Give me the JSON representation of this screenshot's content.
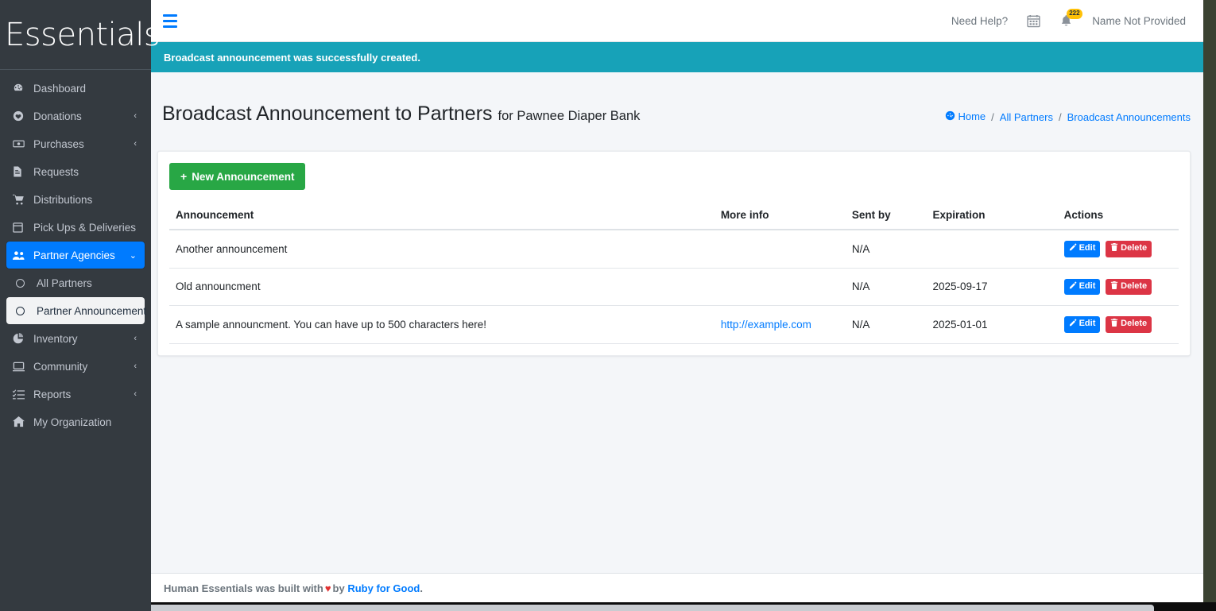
{
  "brand": {
    "name": "Essentials"
  },
  "sidebar": {
    "items": [
      {
        "label": "Dashboard",
        "icon": "dashboard-icon",
        "glyph": "◔",
        "caret": "",
        "state": "normal"
      },
      {
        "label": "Donations",
        "icon": "heart-circle-icon",
        "glyph": "♥",
        "caret": "‹",
        "state": "normal"
      },
      {
        "label": "Purchases",
        "icon": "money-bill-icon",
        "glyph": "▣",
        "caret": "‹",
        "state": "normal"
      },
      {
        "label": "Requests",
        "icon": "file-lines-icon",
        "glyph": "☷",
        "caret": "",
        "state": "normal"
      },
      {
        "label": "Distributions",
        "icon": "shopping-cart-icon",
        "glyph": "⛟",
        "caret": "",
        "state": "normal"
      },
      {
        "label": "Pick Ups & Deliveries",
        "icon": "calendar-icon",
        "glyph": "Ὄ5",
        "caret": "",
        "state": "normal"
      },
      {
        "label": "Partner Agencies",
        "icon": "users-icon",
        "glyph": "὆5",
        "caret": "⌄",
        "state": "active"
      },
      {
        "label": "All Partners",
        "icon": "circle-icon",
        "glyph": "",
        "caret": "",
        "state": "sub"
      },
      {
        "label": "Partner Announcement",
        "icon": "circle-icon",
        "glyph": "",
        "caret": "",
        "state": "sub-current"
      },
      {
        "label": "Inventory",
        "icon": "pie-chart-icon",
        "glyph": "◕",
        "caret": "‹",
        "state": "normal"
      },
      {
        "label": "Community",
        "icon": "desktop-icon",
        "glyph": "Ὓ5",
        "caret": "‹",
        "state": "normal"
      },
      {
        "label": "Reports",
        "icon": "list-check-icon",
        "glyph": "☰",
        "caret": "‹",
        "state": "normal"
      },
      {
        "label": "My Organization",
        "icon": "home-icon",
        "glyph": "⌂",
        "caret": "",
        "state": "normal"
      }
    ]
  },
  "topbar": {
    "menu_toggle": "hamburger-icon",
    "need_help": "Need Help?",
    "calendar_icon": "calendar-icon",
    "notifications_icon": "bell-icon",
    "notifications_count": "222",
    "username": "Name Not Provided"
  },
  "flash": {
    "message": "Broadcast announcement was successfully created."
  },
  "page": {
    "title": "Broadcast Announcement to Partners",
    "subtitle": "for Pawnee Diaper Bank"
  },
  "breadcrumb": {
    "home": "Home",
    "all_partners": "All Partners",
    "current": "Broadcast Announcements",
    "sep": "/"
  },
  "actions": {
    "new_announcement": "New Announcement",
    "plus": "+"
  },
  "table": {
    "headers": {
      "announcement": "Announcement",
      "more_info": "More info",
      "sent_by": "Sent by",
      "expiration": "Expiration",
      "actions": "Actions"
    },
    "rows": [
      {
        "announcement": "Another announcement",
        "more_info": "",
        "sent_by": "N/A",
        "expiration": "",
        "edit": "Edit",
        "delete": "Delete"
      },
      {
        "announcement": "Old announcment",
        "more_info": "",
        "sent_by": "N/A",
        "expiration": "2025-09-17",
        "edit": "Edit",
        "delete": "Delete"
      },
      {
        "announcement": "A sample announcment. You can have up to 500 characters here!",
        "more_info": "http://example.com",
        "sent_by": "N/A",
        "expiration": "2025-01-01",
        "edit": "Edit",
        "delete": "Delete"
      }
    ]
  },
  "footer": {
    "prefix": "Human Essentials was built with",
    "heart": "♥",
    "middle": "by",
    "link": "Ruby for Good",
    "suffix": "."
  },
  "colors": {
    "sidebar_bg": "#343a40",
    "accent_blue": "#007bff",
    "flash_teal": "#17a2b8",
    "success_green": "#28a745",
    "danger_red": "#dc3545",
    "badge_yellow": "#ffc107",
    "page_bg": "#f4f6f9"
  }
}
